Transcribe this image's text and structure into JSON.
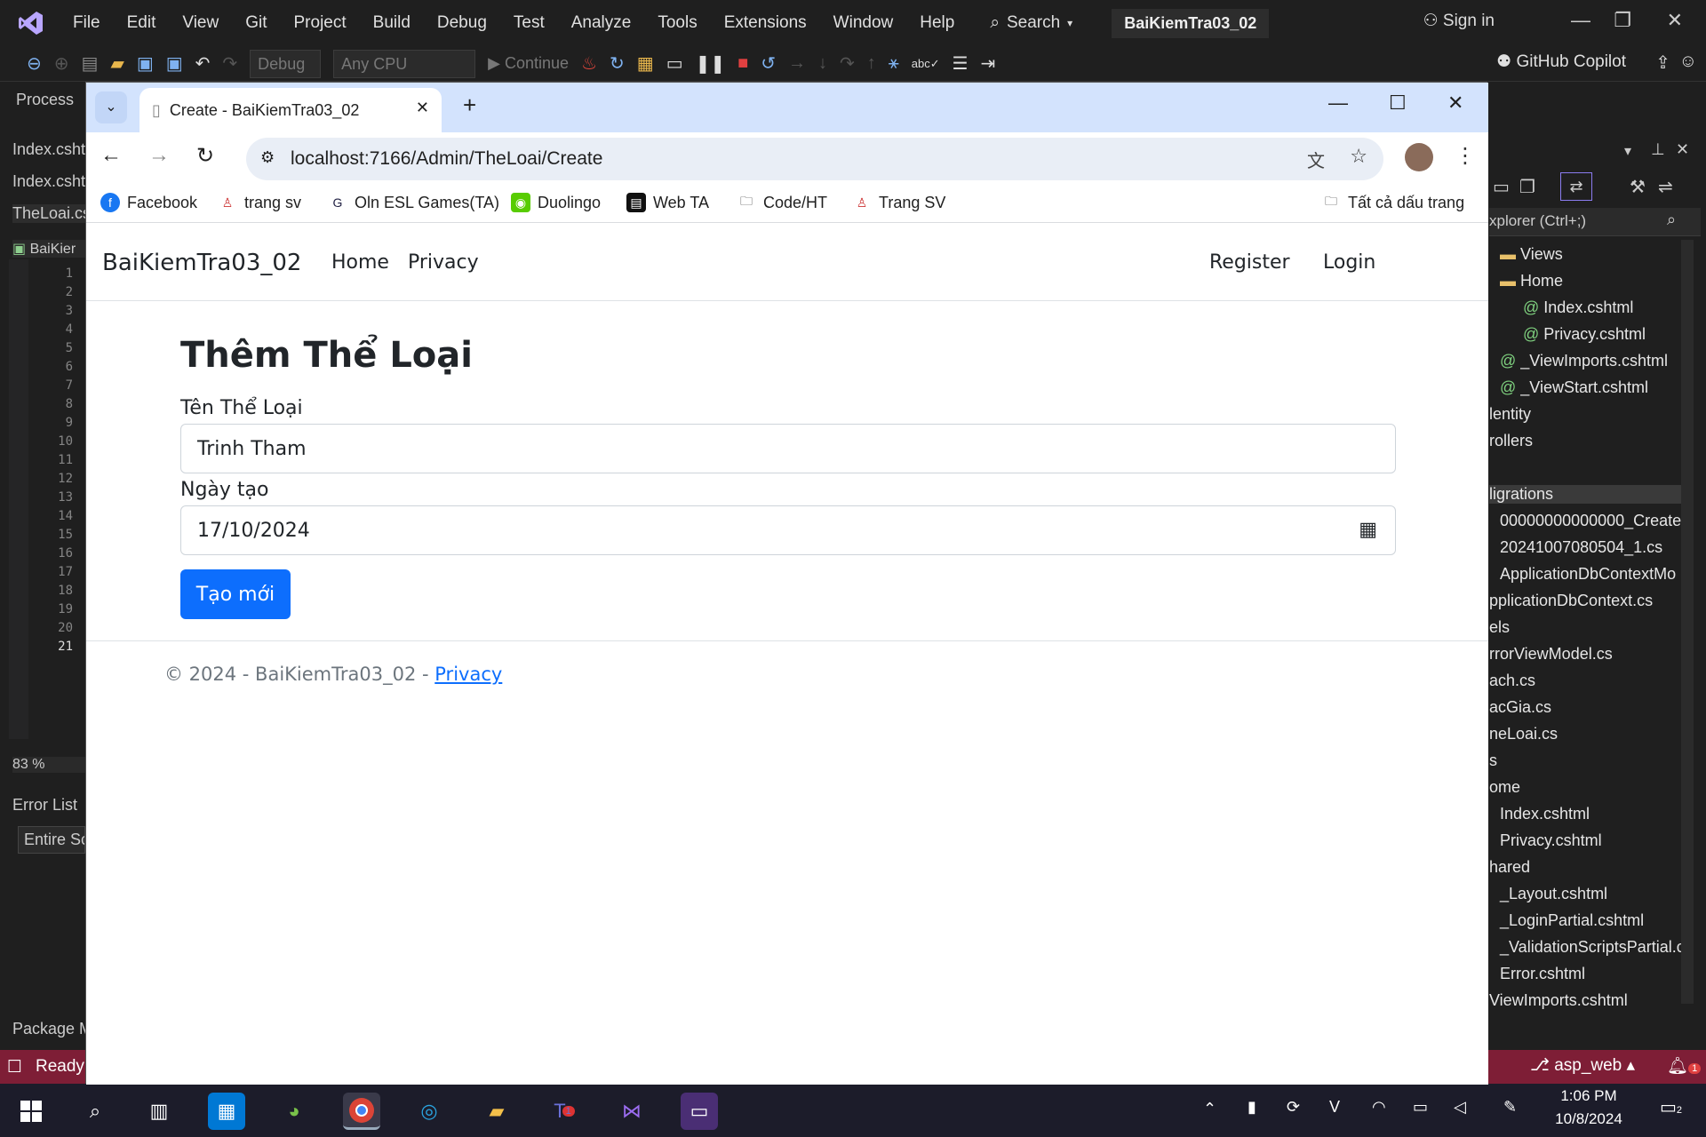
{
  "vs": {
    "menu": [
      "File",
      "Edit",
      "View",
      "Git",
      "Project",
      "Build",
      "Debug",
      "Test",
      "Analyze",
      "Tools",
      "Extensions",
      "Window",
      "Help"
    ],
    "search_label": "Search",
    "solution_name": "BaiKiemTra03_02",
    "sign_in": "Sign in",
    "toolbar": {
      "config": "Debug",
      "platform": "Any CPU",
      "continue": "Continue",
      "copilot": "GitHub Copilot"
    },
    "left": {
      "process_label": "Process",
      "tabs": [
        "Index.csht",
        "Index.csht",
        "TheLoai.cs",
        "BaiKier"
      ],
      "line_numbers": [
        "1",
        "2",
        "3",
        "4",
        "5",
        "6",
        "7",
        "8",
        "9",
        "10",
        "11",
        "12",
        "13",
        "14",
        "15",
        "16",
        "17",
        "18",
        "19",
        "20",
        "21"
      ],
      "zoom": "83 %",
      "error_list": "Error List",
      "entire_scope": "Entire Sc",
      "package": "Package M"
    },
    "explorer": {
      "search_placeholder": "xplorer (Ctrl+;)",
      "items": [
        "Views",
        "Home",
        "Index.cshtml",
        "Privacy.cshtml",
        "_ViewImports.cshtml",
        "_ViewStart.cshtml",
        "lentity",
        "rollers",
        "ligrations",
        "00000000000000_Create",
        "20241007080504_1.cs",
        "ApplicationDbContextMo",
        "pplicationDbContext.cs",
        "els",
        "rrorViewModel.cs",
        "ach.cs",
        "acGia.cs",
        "neLoai.cs",
        "s",
        "ome",
        "Index.cshtml",
        "Privacy.cshtml",
        "hared",
        "_Layout.cshtml",
        "_LoginPartial.cshtml",
        "_ValidationScriptsPartial.c",
        "Error.cshtml",
        "ViewImports.cshtml"
      ]
    },
    "status": {
      "ready": "Ready",
      "branch": "asp_web",
      "notifications": "1"
    }
  },
  "browser": {
    "tab_title": "Create - BaiKiemTra03_02",
    "url": "localhost:7166/Admin/TheLoai/Create",
    "bookmarks": [
      "Facebook",
      "trang sv",
      "Oln ESL Games(TA)",
      "Duolingo",
      "Web TA",
      "Code/HT",
      "Trang SV"
    ],
    "all_bookmarks": "Tất cả dấu trang"
  },
  "page": {
    "brand": "BaiKiemTra03_02",
    "nav": {
      "home": "Home",
      "privacy": "Privacy",
      "register": "Register",
      "login": "Login"
    },
    "title": "Thêm Thể Loại",
    "name_label": "Tên Thể Loại",
    "name_value": "Trinh Tham",
    "date_label": "Ngày tạo",
    "date_value": "17/10/2024",
    "submit": "Tạo mới",
    "footer_text": "© 2024 - BaiKiemTra03_02 - ",
    "footer_link": "Privacy"
  },
  "taskbar": {
    "time": "1:06 PM",
    "date": "10/8/2024",
    "teams_badge": "1",
    "notif_badge": "2"
  },
  "colors": {
    "accent": "#0d6efd",
    "status_bar": "#7e1e36",
    "tabstrip": "#d3e3fd"
  }
}
